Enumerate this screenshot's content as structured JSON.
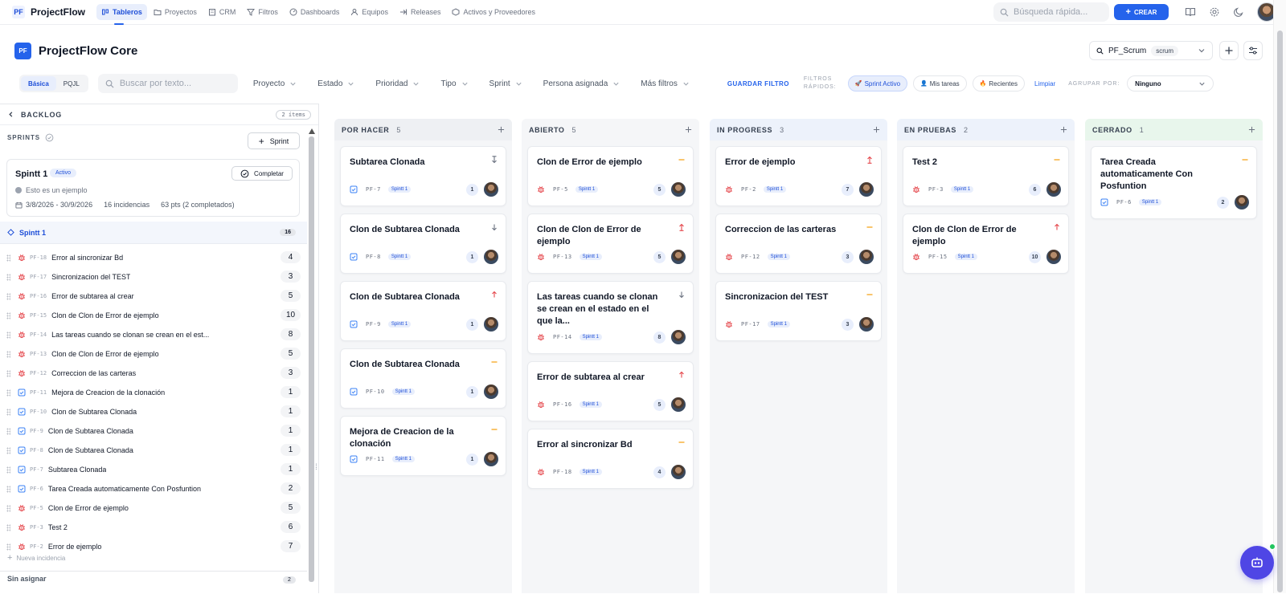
{
  "app": {
    "name": "ProjectFlow",
    "logo_mark": "PF"
  },
  "nav": [
    {
      "label": "Tableros",
      "icon": "board-icon",
      "active": true
    },
    {
      "label": "Proyectos",
      "icon": "folder-icon"
    },
    {
      "label": "CRM",
      "icon": "building-icon"
    },
    {
      "label": "Filtros",
      "icon": "filter-icon"
    },
    {
      "label": "Dashboards",
      "icon": "dashboard-icon"
    },
    {
      "label": "Equipos",
      "icon": "users-icon"
    },
    {
      "label": "Releases",
      "icon": "release-icon"
    },
    {
      "label": "Activos y Proveedores",
      "icon": "assets-icon"
    }
  ],
  "topbar": {
    "search_placeholder": "Búsqueda rápida...",
    "create_label": "CREAR"
  },
  "project": {
    "badge": "PF",
    "title": "ProjectFlow Core"
  },
  "board_select": {
    "name": "PF_Scrum",
    "tag": "scrum"
  },
  "filters": {
    "modes": [
      "Básica",
      "PQJL"
    ],
    "active_mode": "Básica",
    "search_placeholder": "Buscar por texto...",
    "dropdowns": [
      "Proyecto",
      "Estado",
      "Prioridad",
      "Tipo",
      "Sprint",
      "Persona asignada",
      "Más filtros"
    ],
    "save_label": "GUARDAR FILTRO",
    "quick_label": "FILTROS RÁPIDOS:",
    "quick": [
      {
        "label": "Sprint Activo",
        "active": true
      },
      {
        "label": "Mis tareas"
      },
      {
        "label": "Recientes"
      }
    ],
    "clear_label": "Limpiar",
    "group_label": "AGRUPAR POR:",
    "group_value": "Ninguno"
  },
  "backlog": {
    "title": "BACKLOG",
    "items_count": "2 ítems",
    "sprints_label": "SPRINTS",
    "add_sprint_label": "Sprint",
    "sprint": {
      "name": "Spintt 1",
      "status": "Activo",
      "complete_label": "Completar",
      "goal": "Esto es un ejemplo",
      "dates": "3/8/2026 - 30/9/2026",
      "issues": "16 incidencias",
      "points": "63 pts (2 completados)"
    },
    "sprint_header": {
      "name": "Spintt 1",
      "count": "16"
    },
    "issues": [
      {
        "type": "bug",
        "key": "PF-18",
        "title": "Error al sincronizar Bd",
        "pts": "4"
      },
      {
        "type": "bug",
        "key": "PF-17",
        "title": "Sincronizacion del TEST",
        "pts": "3"
      },
      {
        "type": "bug",
        "key": "PF-16",
        "title": "Error de subtarea al crear",
        "pts": "5"
      },
      {
        "type": "bug",
        "key": "PF-15",
        "title": "Clon de Clon de Error de ejemplo",
        "pts": "10"
      },
      {
        "type": "bug",
        "key": "PF-14",
        "title": "Las tareas cuando se clonan se crean en el est...",
        "pts": "8"
      },
      {
        "type": "bug",
        "key": "PF-13",
        "title": "Clon de Clon de Error de ejemplo",
        "pts": "5"
      },
      {
        "type": "bug",
        "key": "PF-12",
        "title": "Correccion de las carteras",
        "pts": "3"
      },
      {
        "type": "task",
        "key": "PF-11",
        "title": "Mejora de Creacion de la clonación",
        "pts": "1"
      },
      {
        "type": "task",
        "key": "PF-10",
        "title": "Clon de Subtarea Clonada",
        "pts": "1"
      },
      {
        "type": "task",
        "key": "PF-9",
        "title": "Clon de Subtarea Clonada",
        "pts": "1"
      },
      {
        "type": "task",
        "key": "PF-8",
        "title": "Clon de Subtarea Clonada",
        "pts": "1"
      },
      {
        "type": "task",
        "key": "PF-7",
        "title": "Subtarea Clonada",
        "pts": "1"
      },
      {
        "type": "task",
        "key": "PF-6",
        "title": "Tarea Creada automaticamente Con Posfuntion",
        "pts": "2"
      },
      {
        "type": "bug",
        "key": "PF-5",
        "title": "Clon de Error de ejemplo",
        "pts": "5"
      },
      {
        "type": "bug",
        "key": "PF-3",
        "title": "Test 2",
        "pts": "6"
      },
      {
        "type": "bug",
        "key": "PF-2",
        "title": "Error de ejemplo",
        "pts": "7"
      }
    ],
    "new_issue_label": "Nueva incidencia",
    "unassigned": {
      "label": "Sin asignar",
      "count": "2"
    }
  },
  "columns": [
    {
      "name": "POR HACER",
      "count": "5",
      "head_color": "#eef0f3",
      "cards": [
        {
          "title": "Subtarea Clonada",
          "prio": "lowest",
          "type": "task",
          "key": "PF-7",
          "sprint": "Spintt 1",
          "pts": "1"
        },
        {
          "title": "Clon de Subtarea Clonada",
          "prio": "low",
          "type": "task",
          "key": "PF-8",
          "sprint": "Spintt 1",
          "pts": "1"
        },
        {
          "title": "Clon de Subtarea Clonada",
          "prio": "high",
          "type": "task",
          "key": "PF-9",
          "sprint": "Spintt 1",
          "pts": "1"
        },
        {
          "title": "Clon de Subtarea Clonada",
          "prio": "medium",
          "type": "task",
          "key": "PF-10",
          "sprint": "Spintt 1",
          "pts": "1"
        },
        {
          "title": "Mejora de Creacion de la clonación",
          "prio": "medium",
          "type": "task",
          "key": "PF-11",
          "sprint": "Spintt 1",
          "pts": "1"
        }
      ]
    },
    {
      "name": "ABIERTO",
      "count": "5",
      "head_color": "#f5f6f8",
      "cards": [
        {
          "title": "Clon de Error de ejemplo",
          "prio": "medium",
          "type": "bug",
          "key": "PF-5",
          "sprint": "Spintt 1",
          "pts": "5"
        },
        {
          "title": "Clon de Clon de Error de ejemplo",
          "prio": "highest",
          "type": "bug",
          "key": "PF-13",
          "sprint": "Spintt 1",
          "pts": "5"
        },
        {
          "title": "Las tareas cuando se clonan se crean en el estado en el que la...",
          "prio": "low",
          "type": "bug",
          "key": "PF-14",
          "sprint": "Spintt 1",
          "pts": "8"
        },
        {
          "title": "Error de subtarea al crear",
          "prio": "high",
          "type": "bug",
          "key": "PF-16",
          "sprint": "Spintt 1",
          "pts": "5"
        },
        {
          "title": "Error al sincronizar Bd",
          "prio": "medium",
          "type": "bug",
          "key": "PF-18",
          "sprint": "Spintt 1",
          "pts": "4"
        }
      ]
    },
    {
      "name": "IN PROGRESS",
      "count": "3",
      "head_color": "#edf2fb",
      "cards": [
        {
          "title": "Error de ejemplo",
          "prio": "highest",
          "type": "bug",
          "key": "PF-2",
          "sprint": "Spintt 1",
          "pts": "7"
        },
        {
          "title": "Correccion de las carteras",
          "prio": "medium",
          "type": "bug",
          "key": "PF-12",
          "sprint": "Spintt 1",
          "pts": "3"
        },
        {
          "title": "Sincronizacion del TEST",
          "prio": "medium",
          "type": "bug",
          "key": "PF-17",
          "sprint": "Spintt 1",
          "pts": "3"
        }
      ]
    },
    {
      "name": "EN PRUEBAS",
      "count": "2",
      "head_color": "#edf2fb",
      "cards": [
        {
          "title": "Test 2",
          "prio": "medium",
          "type": "bug",
          "key": "PF-3",
          "sprint": "Spintt 1",
          "pts": "6"
        },
        {
          "title": "Clon de Clon de Error de ejemplo",
          "prio": "high",
          "type": "bug",
          "key": "PF-15",
          "sprint": "Spintt 1",
          "pts": "10"
        }
      ]
    },
    {
      "name": "CERRADO",
      "count": "1",
      "head_color": "#e8f6ec",
      "cards": [
        {
          "title": "Tarea Creada automaticamente Con Posfuntion",
          "prio": "medium",
          "type": "task",
          "key": "PF-6",
          "sprint": "Spintt 1",
          "pts": "2"
        }
      ]
    }
  ],
  "colors": {
    "accent": "#2563eb",
    "bug": "#e5484d",
    "task": "#3b82f6",
    "prio_high": "#e5484d",
    "prio_medium": "#f59e0b",
    "prio_low": "#6b7280",
    "fab": "#4f46e5"
  }
}
